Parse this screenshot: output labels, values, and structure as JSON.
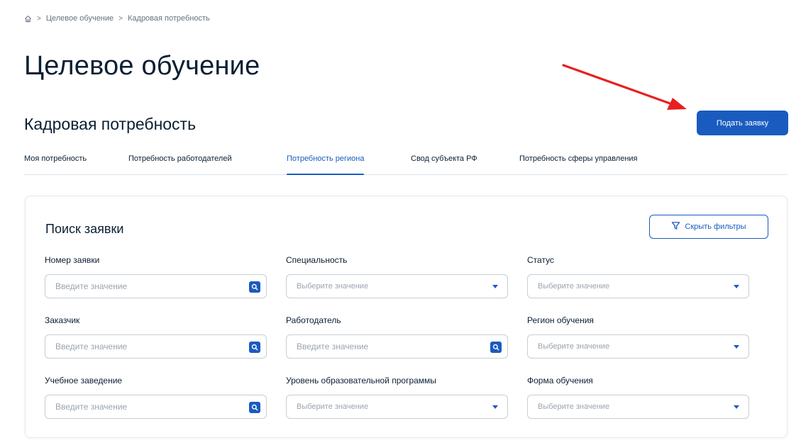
{
  "breadcrumb": {
    "home_icon": "home-icon",
    "items": [
      "Целевое обучение",
      "Кадровая потребность"
    ]
  },
  "page_title": "Целевое обучение",
  "section_title": "Кадровая потребность",
  "submit_button": "Подать заявку",
  "tabs": [
    {
      "label": "Моя потребность",
      "active": false
    },
    {
      "label": "Потребность работодателей",
      "active": false
    },
    {
      "label": "Потребность региона",
      "active": true
    },
    {
      "label": "Свод субъекта РФ",
      "active": false
    },
    {
      "label": "Потребность сферы управления",
      "active": false
    }
  ],
  "search": {
    "title": "Поиск заявки",
    "hide_filters_button": "Скрыть фильтры",
    "fields": {
      "request_number": {
        "label": "Номер заявки",
        "placeholder": "Введите значение",
        "type": "input"
      },
      "specialty": {
        "label": "Специальность",
        "placeholder": "Выберите значение",
        "type": "select"
      },
      "status": {
        "label": "Статус",
        "placeholder": "Выберите значение",
        "type": "select"
      },
      "customer": {
        "label": "Заказчик",
        "placeholder": "Введите значение",
        "type": "input"
      },
      "employer": {
        "label": "Работодатель",
        "placeholder": "Введите значение",
        "type": "input"
      },
      "study_region": {
        "label": "Регион обучения",
        "placeholder": "Выберите значение",
        "type": "select"
      },
      "institution": {
        "label": "Учебное заведение",
        "placeholder": "Введите значение",
        "type": "input"
      },
      "program_level": {
        "label": "Уровень образовательной программы",
        "placeholder": "Выберите значение",
        "type": "select"
      },
      "study_form": {
        "label": "Форма обучения",
        "placeholder": "Выберите значение",
        "type": "select"
      }
    }
  },
  "colors": {
    "accent": "#1a5bbf",
    "annotation_arrow": "#e8201f",
    "text": "#0b1f33",
    "muted": "#66727f"
  },
  "icons": {
    "search": "search-icon",
    "dropdown": "caret-down-icon",
    "filter": "filter-icon"
  }
}
